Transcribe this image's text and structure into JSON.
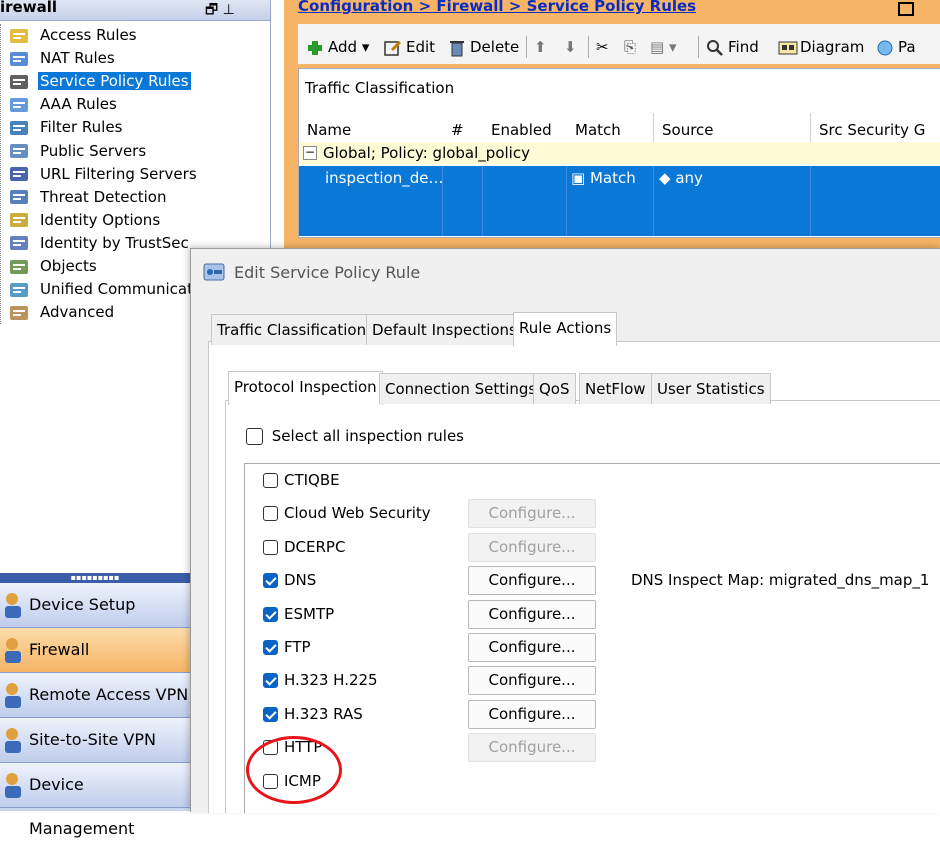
{
  "left_panel": {
    "title": "irewall",
    "tree": [
      {
        "label": "Access Rules",
        "icon": "access-rules-icon"
      },
      {
        "label": "NAT Rules",
        "icon": "nat-rules-icon"
      },
      {
        "label": "Service Policy Rules",
        "icon": "service-policy-icon",
        "selected": true
      },
      {
        "label": "AAA Rules",
        "icon": "aaa-rules-icon"
      },
      {
        "label": "Filter Rules",
        "icon": "filter-rules-icon"
      },
      {
        "label": "Public Servers",
        "icon": "public-servers-icon"
      },
      {
        "label": "URL Filtering Servers",
        "icon": "url-filtering-icon"
      },
      {
        "label": "Threat Detection",
        "icon": "threat-detection-icon"
      },
      {
        "label": "Identity Options",
        "icon": "identity-options-icon"
      },
      {
        "label": "Identity by TrustSec",
        "icon": "trustsec-icon"
      },
      {
        "label": "Objects",
        "icon": "objects-icon"
      },
      {
        "label": "Unified Communications",
        "icon": "unified-comm-icon"
      },
      {
        "label": "Advanced",
        "icon": "advanced-icon"
      }
    ]
  },
  "nav_buttons": [
    {
      "label": "Device Setup",
      "active": false
    },
    {
      "label": "Firewall",
      "active": true
    },
    {
      "label": "Remote Access VPN",
      "active": false
    },
    {
      "label": "Site-to-Site VPN",
      "active": false
    },
    {
      "label": "Device Management",
      "active": false
    }
  ],
  "config": {
    "breadcrumb": "Configuration > Firewall > Service Policy Rules",
    "toolbar": {
      "add": "Add",
      "edit": "Edit",
      "delete": "Delete",
      "find": "Find",
      "diagram": "Diagram",
      "packet": "Pa"
    },
    "grid": {
      "caption": "Traffic Classification",
      "columns": [
        "Name",
        "#",
        "Enabled",
        "Match",
        "Source",
        "Src Security G"
      ],
      "group_row": "Global; Policy: global_policy",
      "row": {
        "name": "inspection_de…",
        "match": "Match",
        "source": "any"
      }
    }
  },
  "dialog": {
    "title": "Edit Service Policy Rule",
    "tabs": [
      "Traffic Classification",
      "Default Inspections",
      "Rule Actions"
    ],
    "active_tab": "Rule Actions",
    "sub_tabs": [
      "Protocol Inspection",
      "Connection Settings",
      "QoS",
      "NetFlow",
      "User Statistics"
    ],
    "active_sub_tab": "Protocol Inspection",
    "select_all": "Select all inspection rules",
    "configure_label": "Configure...",
    "rules": [
      {
        "label": "CTIQBE",
        "checked": false,
        "configure": false
      },
      {
        "label": "Cloud Web Security",
        "checked": false,
        "configure": "disabled"
      },
      {
        "label": "DCERPC",
        "checked": false,
        "configure": "disabled"
      },
      {
        "label": "DNS",
        "checked": true,
        "configure": "enabled",
        "note": "DNS Inspect Map: migrated_dns_map_1"
      },
      {
        "label": "ESMTP",
        "checked": true,
        "configure": "enabled"
      },
      {
        "label": "FTP",
        "checked": true,
        "configure": "enabled"
      },
      {
        "label": "H.323 H.225",
        "checked": true,
        "configure": "enabled"
      },
      {
        "label": "H.323 RAS",
        "checked": true,
        "configure": "enabled"
      },
      {
        "label": "HTTP",
        "checked": false,
        "configure": "disabled"
      },
      {
        "label": "ICMP",
        "checked": false,
        "configure": false
      }
    ]
  },
  "colors": {
    "selection": "#0a78d7",
    "orange_header": "#f6b466",
    "annotation_red": "#e8141b",
    "checkbox_blue": "#0a64c8"
  }
}
